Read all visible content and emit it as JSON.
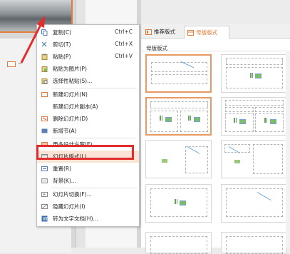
{
  "context_menu": {
    "items": [
      {
        "label": "复制(C)",
        "shortcut": "Ctrl+C",
        "icon": "copy-icon"
      },
      {
        "label": "剪切(T)",
        "shortcut": "Ctrl+X",
        "icon": "cut-icon"
      },
      {
        "label": "粘贴(P)",
        "shortcut": "Ctrl+V",
        "icon": "paste-icon"
      },
      {
        "label": "粘贴为图片(P)",
        "shortcut": "",
        "icon": "paste-image-icon"
      },
      {
        "label": "选择性粘贴(S)...",
        "shortcut": "",
        "icon": "paste-special-icon"
      },
      {
        "label": "新建幻灯片(N)",
        "shortcut": "",
        "icon": "new-slide-icon"
      },
      {
        "label": "新建幻灯片副本(A)",
        "shortcut": "",
        "icon": ""
      },
      {
        "label": "删除幻灯片(D)",
        "shortcut": "",
        "icon": "delete-slide-icon"
      },
      {
        "label": "新增节(A)",
        "shortcut": "",
        "icon": "new-section-icon"
      },
      {
        "label": "更多设计方案(E)...",
        "shortcut": "",
        "icon": "design-icon"
      },
      {
        "label": "幻灯片版式(L)...",
        "shortcut": "",
        "icon": "layout-icon"
      },
      {
        "label": "重置(R)",
        "shortcut": "",
        "icon": "reset-icon"
      },
      {
        "label": "背景(K)...",
        "shortcut": "",
        "icon": "background-icon"
      },
      {
        "label": "幻灯片切换(F)...",
        "shortcut": "",
        "icon": "transition-icon"
      },
      {
        "label": "隐藏幻灯片(I)",
        "shortcut": "",
        "icon": "hide-slide-icon"
      },
      {
        "label": "转为文字文档(H)...",
        "shortcut": "",
        "icon": "to-document-icon"
      }
    ]
  },
  "layout_panel": {
    "tabs": [
      {
        "label": "推荐版式",
        "icon": "recommend-icon"
      },
      {
        "label": "母版版式",
        "icon": "master-icon"
      }
    ],
    "section_label": "母版版式"
  },
  "colors": {
    "accent": "#e07b39",
    "highlight_box": "#e32c2c",
    "arrow": "#e32c2c"
  }
}
